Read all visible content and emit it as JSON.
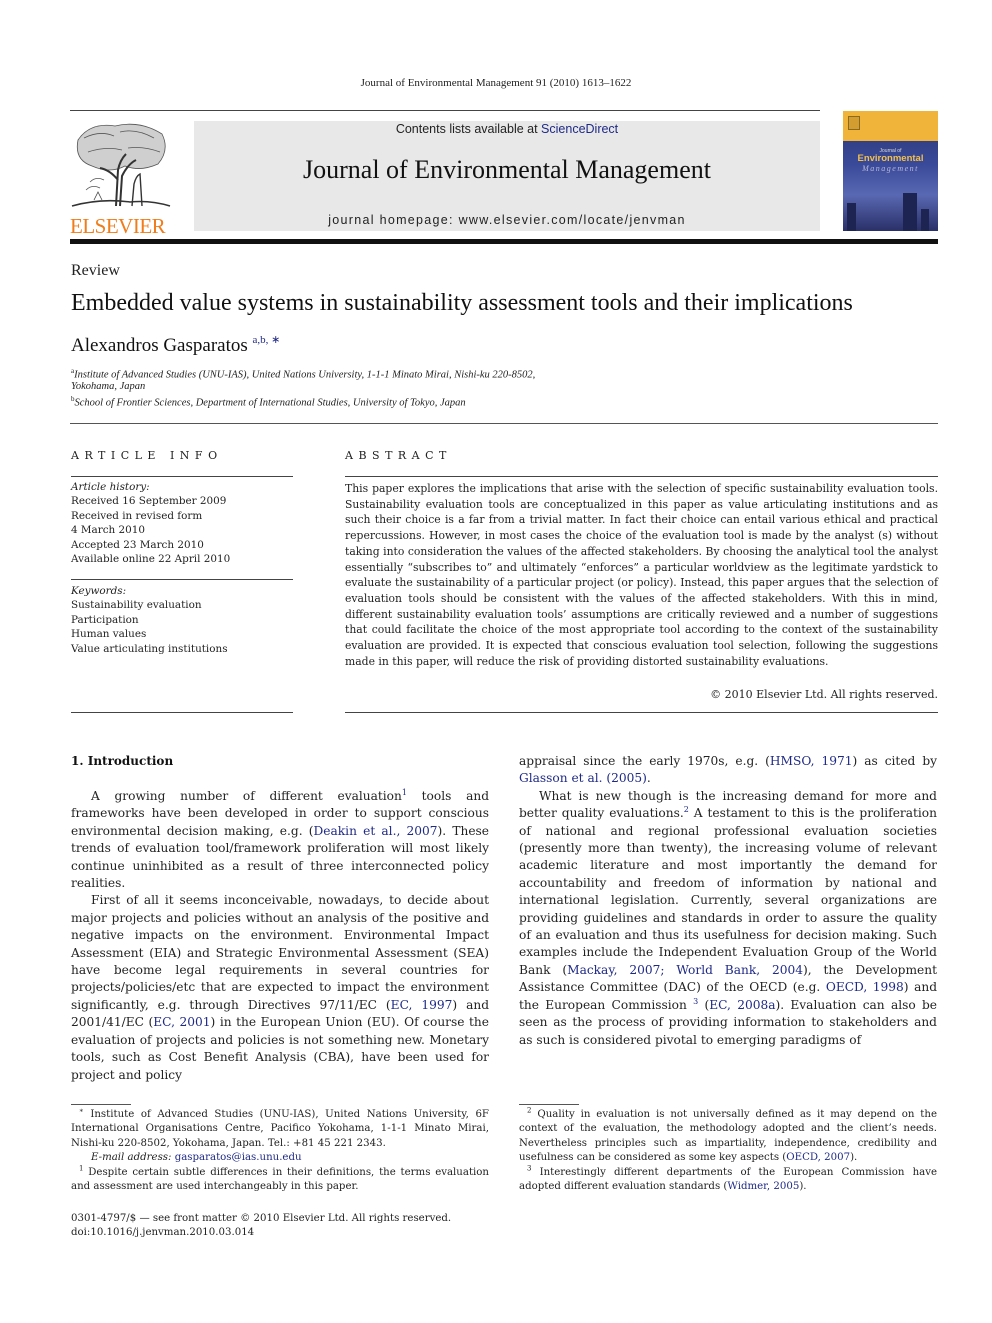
{
  "running_head": "Journal of Environmental Management 91 (2010) 1613–1622",
  "publisher": {
    "logo_text": "ELSEVIER",
    "logo_color": "#f07c1a"
  },
  "banner": {
    "contents_prefix": "Contents lists available at ",
    "contents_link": "ScienceDirect",
    "journal_title": "Journal of Environmental Management",
    "homepage": "journal homepage: www.elsevier.com/locate/jenvman",
    "background": "#e8e8e8"
  },
  "cover": {
    "small": "Journal of",
    "big": "Environmental",
    "italic": "Management"
  },
  "article": {
    "type": "Review",
    "title": "Embedded value systems in sustainability assessment tools and their implications",
    "author": "Alexandros Gasparatos",
    "author_marks": "a,b,",
    "author_star": "∗",
    "affiliations": [
      {
        "mark": "a",
        "lines": [
          "Institute of Advanced Studies (UNU-IAS), United Nations University, 1-1-1 Minato Mirai, Nishi-ku 220-8502,",
          "Yokohama, Japan"
        ]
      },
      {
        "mark": "b",
        "lines": [
          "School of Frontier Sciences, Department of International Studies, University of Tokyo, Japan"
        ]
      }
    ]
  },
  "article_info": {
    "heading": "ARTICLE INFO",
    "history_label": "Article history:",
    "history": [
      "Received 16 September 2009",
      "Received in revised form",
      "4 March 2010",
      "Accepted 23 March 2010",
      "Available online 22 April 2010"
    ],
    "keywords_label": "Keywords:",
    "keywords": [
      "Sustainability evaluation",
      "Participation",
      "Human values",
      "Value articulating institutions"
    ]
  },
  "abstract": {
    "heading": "ABSTRACT",
    "text": "This paper explores the implications that arise with the selection of specific sustainability evaluation tools. Sustainability evaluation tools are conceptualized in this paper as value articulating institutions and as such their choice is a far from a trivial matter. In fact their choice can entail various ethical and practical repercussions. However, in most cases the choice of the evaluation tool is made by the analyst (s) without taking into consideration the values of the affected stakeholders. By choosing the analytical tool the analyst essentially “subscribes to” and ultimately “enforces” a particular worldview as the legitimate yardstick to evaluate the sustainability of a particular project (or policy). Instead, this paper argues that the selection of evaluation tools should be consistent with the values of the affected stakeholders. With this in mind, different sustainability evaluation tools’ assumptions are critically reviewed and a number of suggestions that could facilitate the choice of the most appropriate tool according to the context of the sustainability evaluation are provided. It is expected that conscious evaluation tool selection, following the suggestions made in this paper, will reduce the risk of providing distorted sustainability evaluations.",
    "copyright": "© 2010 Elsevier Ltd. All rights reserved."
  },
  "body": {
    "section_heading": "1.  Introduction",
    "left": {
      "p1": {
        "a": "A growing number of different evaluation",
        "fn": "1",
        "b": " tools and frameworks have been developed in order to support conscious environmental decision making, e.g. (",
        "cite1": "Deakin et al., 2007",
        "c": "). These trends of evaluation tool/framework proliferation will most likely continue uninhibited as a result of three interconnected policy realities."
      },
      "p2": {
        "a": "First of all it seems inconceivable, nowadays, to decide about major projects and policies without an analysis of the positive and negative impacts on the environment. Environmental Impact Assessment (EIA) and Strategic Environmental Assessment (SEA) have become legal requirements in several countries for projects/policies/etc that are expected to impact the environment significantly, e.g. through Directives 97/11/EC (",
        "cite1": "EC, 1997",
        "b": ") and 2001/41/EC (",
        "cite2": "EC, 2001",
        "c": ") in the European Union (EU). Of course the evaluation of projects and policies is not something new. Monetary tools, such as Cost Benefit Analysis (CBA), have been used for project and policy"
      }
    },
    "right": {
      "p1": {
        "a": "appraisal since the early 1970s, e.g. (",
        "cite1": "HMSO, 1971",
        "b": ") as cited by ",
        "cite2": "Glasson et al. (2005)",
        "c": "."
      },
      "p2": {
        "a": "What is new though is the increasing demand for more and better quality evaluations.",
        "fn": "2",
        "b": " A testament to this is the proliferation of national and regional professional evaluation societies (presently more than twenty), the increasing volume of relevant academic literature and most importantly the demand for accountability and freedom of information by national and international legislation. Currently, several organizations are providing guidelines and standards in order to assure the quality of an evaluation and thus its usefulness for decision making. Such examples include the Independent Evaluation Group of the World Bank (",
        "cite1": "Mackay, 2007; World Bank, 2004",
        "c": "), the Development Assistance Committee (DAC) of the OECD (e.g. ",
        "cite2": "OECD, 1998",
        "d": ") and the European Commission ",
        "fn2": "3",
        "e": " (",
        "cite3": "EC, 2008a",
        "f": "). Evaluation can also be seen as the process of providing information to stakeholders and as such is considered pivotal to emerging paradigms of"
      }
    }
  },
  "footnotes": {
    "left": {
      "star": "∗",
      "star_text": " Institute of Advanced Studies (UNU-IAS), United Nations University, 6F International Organisations Centre, Pacifico Yokohama, 1-1-1 Minato Mirai, Nishi-ku 220-8502, Yokohama, Japan. Tel.: +81 45 221 2343.",
      "email_label": "E-mail address: ",
      "email": "gasparatos@ias.unu.edu",
      "fn1_mark": "1",
      "fn1_text": " Despite certain subtle differences in their definitions, the terms evaluation and assessment are used interchangeably in this paper."
    },
    "right": {
      "fn2_mark": "2",
      "fn2_text": " Quality in evaluation is not universally defined as it may depend on the context of the evaluation, the methodology adopted and the client’s needs. Nevertheless principles such as impartiality, independence, credibility and usefulness can be considered as some key aspects (",
      "fn2_cite": "OECD, 2007",
      "fn2_end": ").",
      "fn3_mark": "3",
      "fn3_text": " Interestingly different departments of the European Commission have adopted different evaluation standards (",
      "fn3_cite": "Widmer, 2005",
      "fn3_end": ")."
    }
  },
  "front_matter": {
    "issn_line": "0301-4797/$ — see front matter © 2010 Elsevier Ltd. All rights reserved.",
    "doi": "doi:10.1016/j.jenvman.2010.03.014"
  }
}
